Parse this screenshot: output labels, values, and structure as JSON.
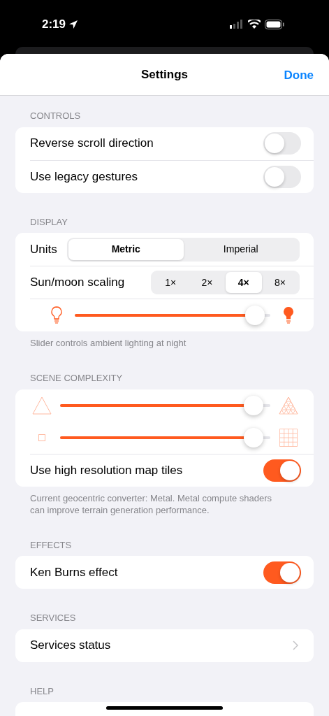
{
  "status_bar": {
    "time": "2:19"
  },
  "nav": {
    "title": "Settings",
    "done": "Done"
  },
  "sections": [
    {
      "header": "CONTROLS",
      "rows": [
        {
          "kind": "toggle",
          "label": "Reverse scroll direction",
          "on": false
        },
        {
          "kind": "toggle",
          "label": "Use legacy gestures",
          "on": false
        }
      ]
    },
    {
      "header": "DISPLAY",
      "rows": [
        {
          "kind": "segmented",
          "label": "Units",
          "options": [
            {
              "label": "Metric",
              "selected": true
            },
            {
              "label": "Imperial",
              "selected": false
            }
          ]
        },
        {
          "kind": "segmented",
          "label": "Sun/moon scaling",
          "options": [
            {
              "label": "1×",
              "selected": false
            },
            {
              "label": "2×",
              "selected": false
            },
            {
              "label": "4×",
              "selected": true
            },
            {
              "label": "8×",
              "selected": false
            }
          ]
        },
        {
          "kind": "slider",
          "level": 0.92
        }
      ],
      "footer": "Slider controls ambient lighting at night"
    },
    {
      "header": "SCENE COMPLEXITY",
      "rows": [
        {
          "kind": "slider",
          "level": 0.92
        },
        {
          "kind": "slider",
          "level": 0.92
        },
        {
          "kind": "toggle",
          "label": "Use high resolution map tiles",
          "on": true
        }
      ],
      "footer": "Current geocentric converter: Metal. Metal compute shaders can improve terrain generation performance."
    },
    {
      "header": "EFFECTS",
      "rows": [
        {
          "kind": "toggle",
          "label": "Ken Burns effect",
          "on": true
        }
      ]
    },
    {
      "header": "SERVICES",
      "rows": [
        {
          "kind": "link",
          "label": "Services status"
        }
      ]
    },
    {
      "header": "HELP"
    }
  ]
}
